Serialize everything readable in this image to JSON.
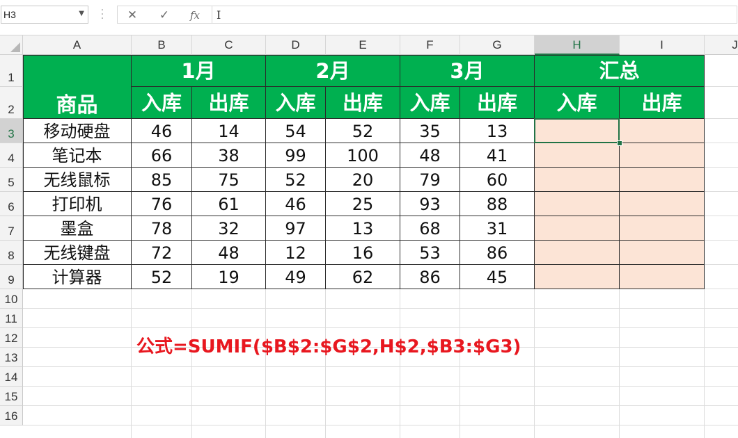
{
  "name_box": {
    "value": "H3"
  },
  "formula_bar": {
    "cancel_symbol": "✕",
    "enter_symbol": "✓",
    "fx_label": "fx",
    "cursor_symbol": "I",
    "content": ""
  },
  "columns": [
    "A",
    "B",
    "C",
    "D",
    "E",
    "F",
    "G",
    "H",
    "I",
    "J"
  ],
  "rows": [
    "1",
    "2",
    "3",
    "4",
    "5",
    "6",
    "7",
    "8",
    "9",
    "10",
    "11",
    "12",
    "13",
    "14",
    "15",
    "16"
  ],
  "header": {
    "product": "商品",
    "months": [
      "1月",
      "2月",
      "3月"
    ],
    "summary": "汇总",
    "in_label": "入库",
    "out_label": "出库"
  },
  "table": {
    "products": [
      "移动硬盘",
      "笔记本",
      "无线鼠标",
      "打印机",
      "墨盒",
      "无线键盘",
      "计算器"
    ],
    "values": [
      [
        "46",
        "14",
        "54",
        "52",
        "35",
        "13"
      ],
      [
        "66",
        "38",
        "99",
        "100",
        "48",
        "41"
      ],
      [
        "85",
        "75",
        "52",
        "20",
        "79",
        "60"
      ],
      [
        "76",
        "61",
        "46",
        "25",
        "93",
        "88"
      ],
      [
        "78",
        "32",
        "97",
        "13",
        "68",
        "31"
      ],
      [
        "72",
        "48",
        "12",
        "16",
        "53",
        "86"
      ],
      [
        "52",
        "19",
        "49",
        "62",
        "86",
        "45"
      ]
    ]
  },
  "formula_note": "公式=SUMIF($B$2:$G$2,H$2,$B3:$G3)",
  "selected_cell": "H3",
  "colors": {
    "header_green": "#00b050",
    "summary_fill": "#fce4d6",
    "note_red": "#e8171f",
    "selection": "#217346"
  }
}
